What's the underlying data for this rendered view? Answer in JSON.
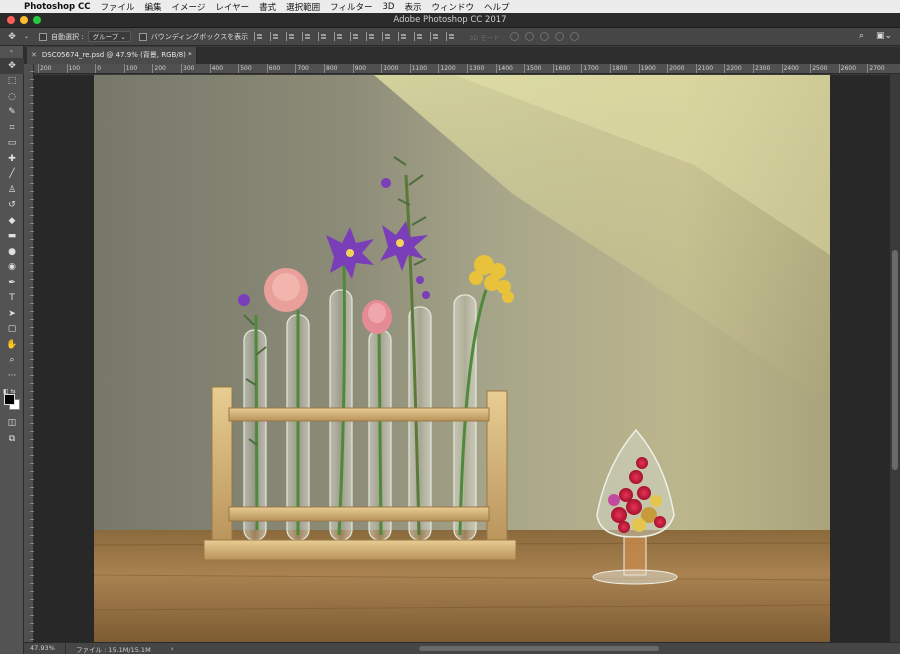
{
  "menubar": {
    "apple_icon": "apple-icon",
    "app_name": "Photoshop CC",
    "items": [
      "ファイル",
      "編集",
      "イメージ",
      "レイヤー",
      "書式",
      "選択範囲",
      "フィルター",
      "3D",
      "表示",
      "ウィンドウ",
      "ヘルプ"
    ]
  },
  "window": {
    "title": "Adobe Photoshop CC 2017"
  },
  "options_bar": {
    "auto_select_label": "自動選択 :",
    "auto_select_value": "グループ",
    "bounding_box_label": "バウンディングボックスを表示",
    "mode_3d_label": "3D モード :",
    "auto_select_checked": false,
    "bounding_box_checked": false
  },
  "document_tab": {
    "close_glyph": "✕",
    "title": "DSC05674_re.psd @ 47.9% (背景, RGB/8) *"
  },
  "ruler": {
    "top_ticks": [
      "200",
      "100",
      "0",
      "100",
      "200",
      "300",
      "400",
      "500",
      "600",
      "700",
      "800",
      "900",
      "1000",
      "1100",
      "1200",
      "1300",
      "1400",
      "1500",
      "1600",
      "1700",
      "1800",
      "1900",
      "2000",
      "2100",
      "2200",
      "2300",
      "2400",
      "2500",
      "2600",
      "2700"
    ]
  },
  "tools": [
    {
      "name": "move-tool-icon",
      "glyph": "✥",
      "active": true
    },
    {
      "name": "marquee-tool-icon",
      "glyph": "⬚"
    },
    {
      "name": "lasso-tool-icon",
      "glyph": "◌"
    },
    {
      "name": "quick-select-tool-icon",
      "glyph": "✎"
    },
    {
      "name": "crop-tool-icon",
      "glyph": "⌗"
    },
    {
      "name": "ruler-tool-icon",
      "glyph": "▭"
    },
    {
      "name": "healing-brush-tool-icon",
      "glyph": "✚"
    },
    {
      "name": "brush-tool-icon",
      "glyph": "╱"
    },
    {
      "name": "clone-stamp-tool-icon",
      "glyph": "♙"
    },
    {
      "name": "history-brush-tool-icon",
      "glyph": "↺"
    },
    {
      "name": "eraser-tool-icon",
      "glyph": "◆"
    },
    {
      "name": "gradient-tool-icon",
      "glyph": "▬"
    },
    {
      "name": "blur-tool-icon",
      "glyph": "●"
    },
    {
      "name": "dodge-tool-icon",
      "glyph": "◉"
    },
    {
      "name": "pen-tool-icon",
      "glyph": "✒"
    },
    {
      "name": "type-tool-icon",
      "glyph": "T"
    },
    {
      "name": "path-select-tool-icon",
      "glyph": "➤"
    },
    {
      "name": "shape-tool-icon",
      "glyph": "▢"
    },
    {
      "name": "hand-tool-icon",
      "glyph": "✋"
    },
    {
      "name": "zoom-tool-icon",
      "glyph": "⌕"
    },
    {
      "name": "more-tools-icon",
      "glyph": "···"
    }
  ],
  "swatches": {
    "foreground": "#000000",
    "background": "#ffffff"
  },
  "status_bar": {
    "zoom": "47.93%",
    "file_info": "ファイル : 15.1M/15.1M",
    "arrow": "›"
  },
  "colors": {
    "panel_bg": "#535353",
    "workspace_bg": "#282828",
    "menubar_bg": "#ececec"
  }
}
